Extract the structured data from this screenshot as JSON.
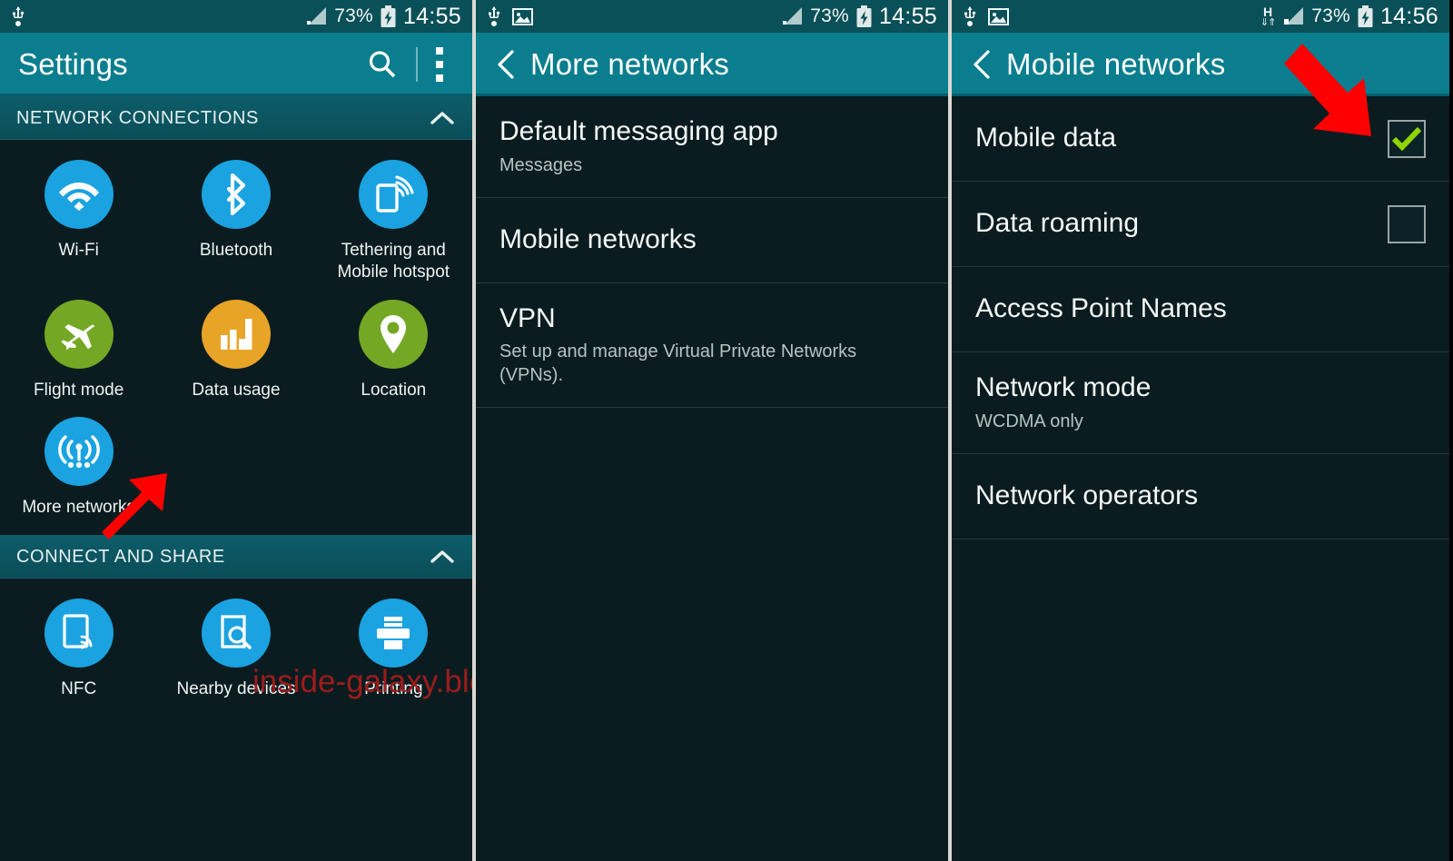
{
  "watermark": {
    "text": "inside-galaxy.blogspot.com"
  },
  "colors": {
    "status_bar": "#0a5058",
    "action_bar": "#0a7e8e",
    "body": "#0a1c20",
    "section_header": "#0d5d6a",
    "icon_blue": "#1aa3e0",
    "icon_green": "#74a824",
    "icon_amber": "#e8a427",
    "checkbox_check": "#8fd400",
    "annotation_arrow": "#fe0000",
    "watermark": "#9e1b1b"
  },
  "panel1": {
    "status": {
      "usb_icon": "usb-icon",
      "signal_icon": "signal-bars-icon",
      "battery_percent": "73%",
      "battery_icon": "battery-charging-icon",
      "clock": "14:55"
    },
    "action_bar": {
      "title": "Settings",
      "search_icon": "search-icon",
      "overflow_icon": "overflow-menu-icon"
    },
    "sections": [
      {
        "header": "NETWORK CONNECTIONS",
        "collapse_icon": "chevron-up-icon",
        "tiles": [
          {
            "label": "Wi-Fi",
            "icon": "wifi-icon",
            "color": "#1aa3e0"
          },
          {
            "label": "Bluetooth",
            "icon": "bluetooth-icon",
            "color": "#1aa3e0"
          },
          {
            "label": "Tethering and Mobile hotspot",
            "icon": "tethering-hotspot-icon",
            "color": "#1aa3e0"
          },
          {
            "label": "Flight mode",
            "icon": "airplane-icon",
            "color": "#74a824"
          },
          {
            "label": "Data usage",
            "icon": "bar-chart-icon",
            "color": "#e8a427"
          },
          {
            "label": "Location",
            "icon": "location-pin-icon",
            "color": "#74a824"
          },
          {
            "label": "More networks",
            "icon": "broadcast-antenna-icon",
            "color": "#1aa3e0"
          }
        ]
      },
      {
        "header": "CONNECT AND SHARE",
        "collapse_icon": "chevron-up-icon",
        "tiles": [
          {
            "label": "NFC",
            "icon": "nfc-icon",
            "color": "#1aa3e0"
          },
          {
            "label": "Nearby devices",
            "icon": "nearby-devices-icon",
            "color": "#1aa3e0"
          },
          {
            "label": "Printing",
            "icon": "printer-icon",
            "color": "#1aa3e0"
          }
        ]
      }
    ],
    "annotation": {
      "target": "More networks",
      "icon": "red-arrow-icon"
    }
  },
  "panel2": {
    "status": {
      "usb_icon": "usb-icon",
      "image_icon": "screenshot-image-icon",
      "signal_icon": "signal-bars-icon",
      "battery_percent": "73%",
      "battery_icon": "battery-charging-icon",
      "clock": "14:55"
    },
    "action_bar": {
      "back_icon": "back-chevron-icon",
      "title": "More networks"
    },
    "rows": [
      {
        "title": "Default messaging app",
        "subtitle": "Messages"
      },
      {
        "title": "Mobile networks",
        "subtitle": ""
      },
      {
        "title": "VPN",
        "subtitle": "Set up and manage Virtual Private Networks (VPNs)."
      }
    ],
    "annotation": {
      "target": "Mobile networks",
      "icon": "red-arrow-icon"
    }
  },
  "panel3": {
    "status": {
      "usb_icon": "usb-icon",
      "image_icon": "screenshot-image-icon",
      "network_type": "H",
      "network_type_icon": "hspa-data-icon",
      "signal_icon": "signal-bars-icon",
      "battery_percent": "73%",
      "battery_icon": "battery-charging-icon",
      "clock": "14:56"
    },
    "action_bar": {
      "back_icon": "back-chevron-icon",
      "title": "Mobile networks"
    },
    "rows": [
      {
        "title": "Mobile data",
        "subtitle": "",
        "checkbox": true,
        "checked": true
      },
      {
        "title": "Data roaming",
        "subtitle": "",
        "checkbox": true,
        "checked": false
      },
      {
        "title": "Access Point Names",
        "subtitle": "",
        "checkbox": false,
        "checked": false
      },
      {
        "title": "Network mode",
        "subtitle": "WCDMA only",
        "checkbox": false,
        "checked": false
      },
      {
        "title": "Network operators",
        "subtitle": "",
        "checkbox": false,
        "checked": false
      }
    ],
    "annotation": {
      "target": "Mobile data",
      "icon": "red-arrow-icon"
    }
  }
}
